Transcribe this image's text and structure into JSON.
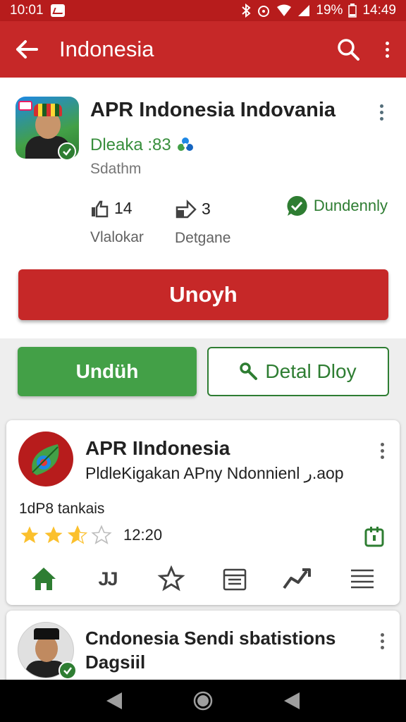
{
  "status_bar": {
    "time": "10:01",
    "battery": "19%",
    "clock_right": "14:49"
  },
  "app_bar": {
    "title": "Indonesia",
    "back_icon": "arrow-left-icon",
    "search_icon": "search-icon",
    "menu_icon": "more-vert-icon"
  },
  "hero": {
    "app_name": "APR Indonesia Indovania",
    "developer": "Dleaka :83",
    "category": "Sdathm",
    "stats": [
      {
        "value": "14",
        "label": "Vlalokar"
      },
      {
        "value": "3",
        "label": "Detgane"
      }
    ],
    "verified_label": "Dundennly",
    "install_label": "Unoyh"
  },
  "actions": {
    "download_label": "Undüh",
    "detail_label": "Detal Dloy"
  },
  "card1": {
    "title": "APR IIndonesia",
    "description": "PldleKigakan APny Ndonnienl ر.aop",
    "meta": "1dP8 tankais",
    "rating": 2.5,
    "time": "12:20",
    "nav_text": "JJ"
  },
  "card2": {
    "title": "Cndonesia Sendi sbatistions Dagsiil"
  },
  "colors": {
    "primary_red": "#c62828",
    "dark_red": "#b71c1c",
    "green": "#43a047"
  }
}
